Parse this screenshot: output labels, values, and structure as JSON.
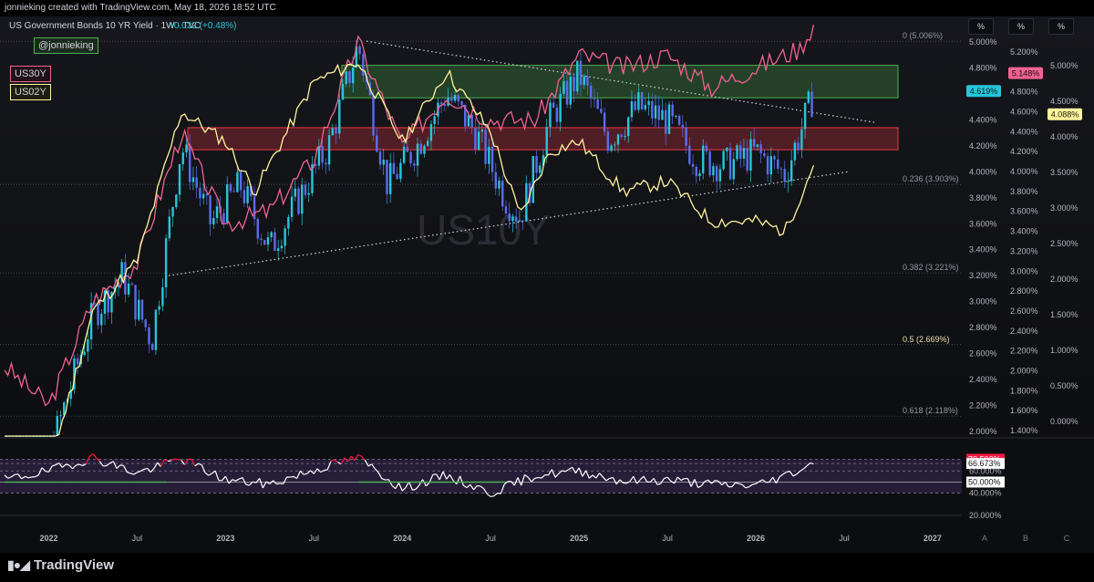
{
  "header": {
    "credit": "jonnieking created with TradingView.com, May 18, 2026 18:52 UTC",
    "symbol_title": "US Government Bonds 10 YR Yield · 1W · TVC",
    "change": "+0.022 (+0.48%)"
  },
  "legend": {
    "author_tag": "@jonnieking",
    "us30y": "US30Y",
    "us02y": "US02Y",
    "watermark": "US10Y"
  },
  "scale_buttons": [
    "%",
    "%",
    "%"
  ],
  "fib_labels": [
    "0 (5.006%)",
    "0.236 (3.903%)",
    "0.382 (3.221%)",
    "0.5 (2.669%)",
    "0.618 (2.118%)"
  ],
  "axis_left": [
    "5.000%",
    "4.800%",
    "4.600%",
    "4.400%",
    "4.200%",
    "4.000%",
    "3.800%",
    "3.600%",
    "3.400%",
    "3.200%",
    "3.000%",
    "2.800%",
    "2.600%",
    "2.400%",
    "2.200%",
    "2.000%"
  ],
  "axis_mid": [
    "5.200%",
    "5.000%",
    "4.800%",
    "4.600%",
    "4.400%",
    "4.200%",
    "4.000%",
    "3.800%",
    "3.600%",
    "3.400%",
    "3.200%",
    "3.000%",
    "2.800%",
    "2.600%",
    "2.400%",
    "2.200%",
    "2.000%",
    "1.800%",
    "1.600%",
    "1.400%"
  ],
  "axis_right": [
    "5.000%",
    "4.500%",
    "4.000%",
    "3.500%",
    "3.000%",
    "2.500%",
    "2.000%",
    "1.500%",
    "1.000%",
    "0.500%",
    "0.000%"
  ],
  "price_tags": {
    "us30y": "5.148%",
    "us10y": "4.619%",
    "us02y": "4.088%"
  },
  "rsi_axis": [
    "70.500%",
    "66.673%",
    "60.000%",
    "50.000%",
    "40.000%",
    "20.000%"
  ],
  "time_axis": [
    "2022",
    "Jul",
    "2023",
    "Jul",
    "2024",
    "Jul",
    "2025",
    "Jul",
    "2026",
    "Jul",
    "2027"
  ],
  "pane_labels": [
    "A",
    "B",
    "C"
  ],
  "brand": "TradingView",
  "colors": {
    "us10y_up": "#26c6da",
    "us10y_down": "#5b6cf0",
    "us30y": "#f06292",
    "us02y": "#fff59d",
    "support_zone": "#f23645",
    "resistance_zone": "#4caf50",
    "rsi": "#ffffff",
    "rsi_overbought": "#ff1744",
    "rsi_mid": "#4caf50"
  },
  "chart_data": {
    "type": "line",
    "title": "US Government Bonds 10 YR Yield · 1W · TVC",
    "x_range": [
      "2021-10",
      "2027-02"
    ],
    "ylim": [
      2.0,
      5.1
    ],
    "grid": false,
    "series": [
      {
        "name": "US10Y",
        "style": "candlestick",
        "x": [
          "2021-10",
          "2022-01",
          "2022-04",
          "2022-06",
          "2022-08",
          "2022-10",
          "2022-12",
          "2023-02",
          "2023-04",
          "2023-06",
          "2023-08",
          "2023-10",
          "2023-12",
          "2024-02",
          "2024-04",
          "2024-06",
          "2024-08",
          "2024-09",
          "2024-11",
          "2025-01",
          "2025-03",
          "2025-05",
          "2025-07",
          "2025-09",
          "2025-11",
          "2026-01",
          "2026-03",
          "2026-04",
          "2026-05"
        ],
        "values": [
          1.5,
          1.8,
          2.9,
          3.2,
          2.7,
          4.2,
          3.6,
          3.9,
          3.4,
          3.8,
          4.2,
          4.98,
          3.9,
          4.2,
          4.6,
          4.3,
          3.8,
          3.65,
          4.4,
          4.75,
          4.25,
          4.5,
          4.4,
          4.1,
          4.05,
          4.15,
          3.98,
          4.3,
          4.619
        ]
      },
      {
        "name": "US30Y",
        "x": [
          "2021-10",
          "2022-01",
          "2022-04",
          "2022-07",
          "2022-10",
          "2023-01",
          "2023-04",
          "2023-07",
          "2023-10",
          "2024-01",
          "2024-04",
          "2024-07",
          "2024-10",
          "2025-01",
          "2025-04",
          "2025-07",
          "2025-10",
          "2026-01",
          "2026-04",
          "2026-05"
        ],
        "values": [
          2.5,
          2.2,
          3.0,
          3.3,
          4.3,
          3.6,
          3.7,
          4.1,
          5.0,
          4.2,
          4.6,
          4.4,
          4.4,
          4.9,
          4.8,
          4.9,
          4.65,
          4.8,
          4.95,
          5.148
        ]
      },
      {
        "name": "US02Y",
        "x": [
          "2021-10",
          "2022-01",
          "2022-04",
          "2022-07",
          "2022-10",
          "2023-01",
          "2023-03",
          "2023-07",
          "2023-10",
          "2024-01",
          "2024-04",
          "2024-07",
          "2024-09",
          "2024-11",
          "2025-01",
          "2025-04",
          "2025-07",
          "2025-10",
          "2026-01",
          "2026-03",
          "2026-05"
        ],
        "values": [
          0.4,
          1.0,
          2.6,
          3.1,
          4.6,
          4.3,
          3.8,
          4.9,
          5.1,
          4.3,
          5.0,
          4.4,
          3.55,
          4.2,
          4.3,
          3.8,
          3.9,
          3.5,
          3.5,
          3.4,
          4.088
        ]
      },
      {
        "name": "RSI",
        "x": [
          "2021-10",
          "2022-01",
          "2022-04",
          "2022-07",
          "2022-10",
          "2023-01",
          "2023-04",
          "2023-07",
          "2023-10",
          "2024-01",
          "2024-04",
          "2024-07",
          "2024-10",
          "2025-01",
          "2025-04",
          "2025-07",
          "2025-10",
          "2026-01",
          "2026-03",
          "2026-05"
        ],
        "values": [
          52,
          60,
          72,
          58,
          71,
          52,
          48,
          61,
          72,
          44,
          56,
          40,
          56,
          60,
          51,
          52,
          48,
          47,
          56,
          66.673
        ]
      }
    ],
    "zones": [
      {
        "name": "resistance",
        "from": 4.57,
        "to": 4.82
      },
      {
        "name": "support",
        "from": 4.17,
        "to": 4.34
      }
    ],
    "fib_levels": [
      5.006,
      3.903,
      3.221,
      2.669,
      2.118
    ],
    "rsi_ylim": [
      20,
      75
    ]
  }
}
